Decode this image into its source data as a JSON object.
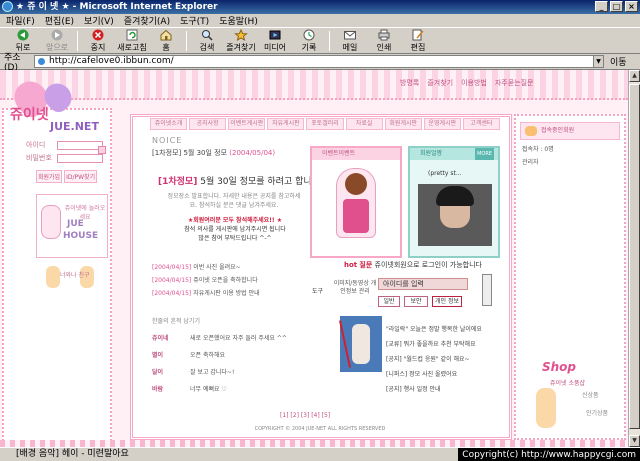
{
  "window": {
    "title": "★ 쥬 이 넷 ★ - Microsoft Internet Explorer"
  },
  "menu": [
    "파일(F)",
    "편집(E)",
    "보기(V)",
    "즐겨찾기(A)",
    "도구(T)",
    "도움말(H)"
  ],
  "toolbar": [
    {
      "label": "뒤로",
      "icon": "back-icon",
      "enabled": true
    },
    {
      "label": "앞으로",
      "icon": "forward-icon",
      "enabled": false
    },
    {
      "label": "중지",
      "icon": "stop-icon",
      "enabled": true
    },
    {
      "label": "새로고침",
      "icon": "refresh-icon",
      "enabled": true
    },
    {
      "label": "홈",
      "icon": "home-icon",
      "enabled": true
    },
    {
      "label": "검색",
      "icon": "search-icon",
      "enabled": true
    },
    {
      "label": "즐겨찾기",
      "icon": "favorites-icon",
      "enabled": true
    },
    {
      "label": "미디어",
      "icon": "media-icon",
      "enabled": true
    },
    {
      "label": "기록",
      "icon": "history-icon",
      "enabled": true
    },
    {
      "label": "메일",
      "icon": "mail-icon",
      "enabled": true
    },
    {
      "label": "인쇄",
      "icon": "print-icon",
      "enabled": true
    },
    {
      "label": "편집",
      "icon": "edit-icon",
      "enabled": true
    }
  ],
  "address": {
    "label": "주소(D)",
    "url": "http://cafelove0.ibbun.com/",
    "go": "이동"
  },
  "status": {
    "text": "[배경 음악] 헤이 - 미련말아요",
    "copyright": "Copyright(c) http://www.happycgi.com"
  },
  "site": {
    "logo_text": "쥬이넷",
    "logo_sub": "JUE.NET",
    "topnav": [
      "방명록",
      "즐겨찾기",
      "이용방법",
      "자주묻는질문"
    ],
    "tabs": [
      "쥬이넷소개",
      "공지사항",
      "이벤트게시판",
      "자유게시판",
      "포토갤러리",
      "자료실",
      "회원게시판",
      "운영게시판",
      "고객센터"
    ],
    "login": {
      "id_label": "아이디",
      "pw_label": "비밀번호"
    },
    "small_buttons": [
      "회원가입",
      "ID/PW찾기"
    ],
    "juehouse": {
      "line1": "쥬이넷에 놀러오세요",
      "line2": "JUE",
      "line3": "HOUSE"
    },
    "kids_caption": "너와나 친구"
  },
  "notice": {
    "header": "NOICE",
    "item": "[1차정모] 5월 30일 정모",
    "item_date": "(2004/05/04)",
    "title_prefix": "[1차정모]",
    "title": "5월 30일 정모를 하려고 합니다",
    "body": "정모장소 발표합니다. 자세한 내용은 공지를 참고하세요. 참석하실 분은 댓글 남겨주세요.",
    "red1": "★회원여러분 모두 참석해주세요!! ★",
    "red2": "참석 의사를 게시판에 남겨주시면 됩니다",
    "red3": "많은 참여 부탁드립니다 ^-^"
  },
  "recent_posts": [
    {
      "date": "[2004/04/15]",
      "title": "이번 사진 올려요~"
    },
    {
      "date": "[2004/04/15]",
      "title": "쥬이넷 오픈을 축하합니다"
    },
    {
      "date": "[2004/04/15]",
      "title": "자유게시판 이용 방법 안내"
    }
  ],
  "photos": {
    "left_header": "이벤트이벤트",
    "right_header": "회원얼짱",
    "right_more": "MORE",
    "right_caption": "(pretty st..."
  },
  "hot": {
    "label": "hot",
    "label2": "질문",
    "text": "쥬이넷회원으로 로그인이 가능합니다"
  },
  "tool": {
    "label": "도구",
    "desc": "이미지/동영상 개인정보 관리",
    "input_value": "아이디를 입력",
    "btn1": "일반",
    "btn2": "보안",
    "btn3": "개인 정보"
  },
  "guestbook": {
    "header": "한줄의 흔적 남기기",
    "rows": [
      {
        "name": "쥬이네",
        "text": "새로 오픈했어요 자주 들러 주세요 ^^"
      },
      {
        "name": "별이",
        "text": "오픈 축하해요"
      },
      {
        "name": "달이",
        "text": "잘 보고 갑니다~!"
      },
      {
        "name": "바람",
        "text": "너무 예뻐요 ♡"
      }
    ]
  },
  "list2": [
    "\"라일락\" 오늘은 정말 행복한 날이에요",
    "[교류] 뭐가 좋을까요 추천 부탁해요",
    "[공지] \"월드컵 응원\" 같이 해요~",
    "[니퍼스] 정모 사진 올렸어요",
    "[공지] 행사 일정 안내"
  ],
  "pager": "[1] [2] [3] [4] [5]",
  "footer": "COPYRIGHT © 2004 JUE-NET ALL RIGHTS RESERVED",
  "right": {
    "online_title": "접속중인회원",
    "online_list": [
      "접속자 : 0명",
      "관리자"
    ],
    "shop_title": "Shop",
    "shop_sub": "쥬이넷 소품샵",
    "shop_l1": "신상품",
    "shop_l2": "인기상품"
  }
}
